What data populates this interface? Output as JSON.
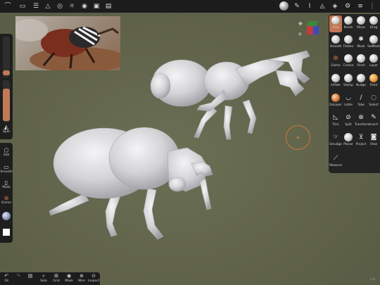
{
  "colors": {
    "background": "#5f6249",
    "panel": "#232323",
    "accent": "#c47551",
    "brush_ring": "#d07a3c",
    "model": "#d9d9db"
  },
  "topbar": {
    "icons": [
      "logo-icon",
      "folder-icon",
      "scene-icon",
      "topology-icon",
      "globe-icon",
      "sun-icon",
      "material-icon",
      "camera-icon",
      "image-icon",
      "material-sphere-icon",
      "brush-stroke-icon",
      "eyedropper-icon",
      "symmetry-icon",
      "layers-icon",
      "settings-icon",
      "sliders-icon",
      "help-icon"
    ]
  },
  "left_panel": {
    "radius_level": 0.35,
    "intensity_level": 0.55,
    "symmetry_label": "Sym",
    "tools": [
      {
        "icon": "sub-icon",
        "label": "Sub"
      },
      {
        "icon": "smooth-icon",
        "label": "Smooth"
      },
      {
        "icon": "mask-icon",
        "label": "Mask"
      },
      {
        "icon": "gizmo-icon",
        "label": "Gizmo"
      }
    ]
  },
  "tools_panel": {
    "tools": [
      {
        "label": "Clay",
        "active": true
      },
      {
        "label": "Brush"
      },
      {
        "label": "Move"
      },
      {
        "label": "Drag"
      },
      {
        "label": "Smooth"
      },
      {
        "label": "Flatten"
      },
      {
        "label": "Mask"
      },
      {
        "label": "SelMask"
      },
      {
        "label": "Gizmo"
      },
      {
        "label": "Crease"
      },
      {
        "label": "Pinch"
      },
      {
        "label": "Layer"
      },
      {
        "label": "Inflate"
      },
      {
        "label": "Stamp"
      },
      {
        "label": "Nudge"
      },
      {
        "label": "Paint"
      },
      {
        "label": "DeLayer"
      },
      {
        "label": "Lathe"
      },
      {
        "label": "Tube"
      },
      {
        "label": "Select"
      },
      {
        "label": "Trim"
      },
      {
        "label": "Split"
      },
      {
        "label": "Transform"
      },
      {
        "label": "Insert"
      },
      {
        "label": "Smudge"
      },
      {
        "label": "Planar"
      },
      {
        "label": "Project"
      },
      {
        "label": "View"
      },
      {
        "label": "Measure"
      }
    ]
  },
  "bottombar": {
    "items": [
      {
        "icon": "undo-icon",
        "label": "18"
      },
      {
        "icon": "redo-icon",
        "label": ""
      },
      {
        "icon": "list-icon",
        "label": ""
      },
      {
        "icon": "solo-icon",
        "label": "Solo"
      },
      {
        "icon": "grid-icon",
        "label": "Grid"
      },
      {
        "icon": "mask-view-icon",
        "label": "Mask"
      },
      {
        "icon": "wire-icon",
        "label": "Wire"
      },
      {
        "icon": "inspect-icon",
        "label": "Inspect"
      }
    ]
  },
  "corner_label": "Lab"
}
